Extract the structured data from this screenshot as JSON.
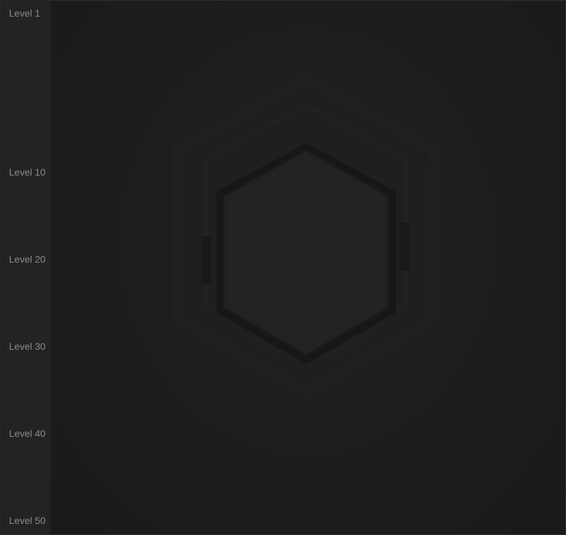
{
  "level_rail": {
    "labels": [
      "Level 1",
      "Level 10",
      "Level 20",
      "Level 30",
      "Level 40",
      "Level 50"
    ]
  },
  "board": {
    "emblem": "hexagon-emblem",
    "colors": {
      "background": "#1d1d1d",
      "rail": "#232323",
      "label": "#8c8c8c",
      "hex_fill": "#242424",
      "hex_edge": "#161616"
    }
  }
}
